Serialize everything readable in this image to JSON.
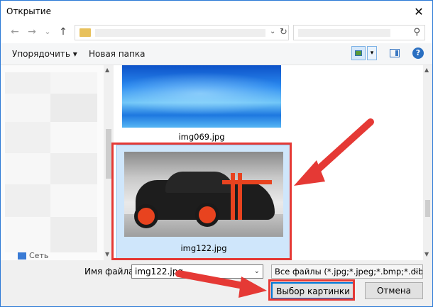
{
  "window": {
    "title": "Открытие",
    "close_glyph": "✕"
  },
  "nav": {
    "back_glyph": "←",
    "forward_glyph": "→",
    "recent_glyph": "⌄",
    "up_glyph": "↑",
    "address_dropdown_glyph": "⌄",
    "refresh_glyph": "↻",
    "search_glyph": "⚲"
  },
  "toolbar": {
    "organize_label": "Упорядочить ▾",
    "new_folder_label": "Новая папка",
    "help_glyph": "?"
  },
  "nav_pane": {
    "item_label": "Сеть"
  },
  "files": [
    {
      "name": "img069.jpg"
    },
    {
      "name": "img122.jpg"
    }
  ],
  "footer": {
    "filename_label": "Имя файла:",
    "filename_value": "img122.jpg",
    "filetype_value": "Все файлы (*.jpg;*.jpeg;*.bmp;*.dib;*.p",
    "open_button_label": "Выбор картинки",
    "cancel_button_label": "Отмена"
  },
  "colors": {
    "accent": "#0078d7",
    "highlight": "#e53935",
    "selection": "#cfe6fb"
  },
  "icons": [
    "close-icon",
    "back-arrow-icon",
    "forward-arrow-icon",
    "up-arrow-icon",
    "folder-icon",
    "refresh-icon",
    "search-icon",
    "view-icon",
    "preview-pane-icon",
    "help-icon"
  ]
}
